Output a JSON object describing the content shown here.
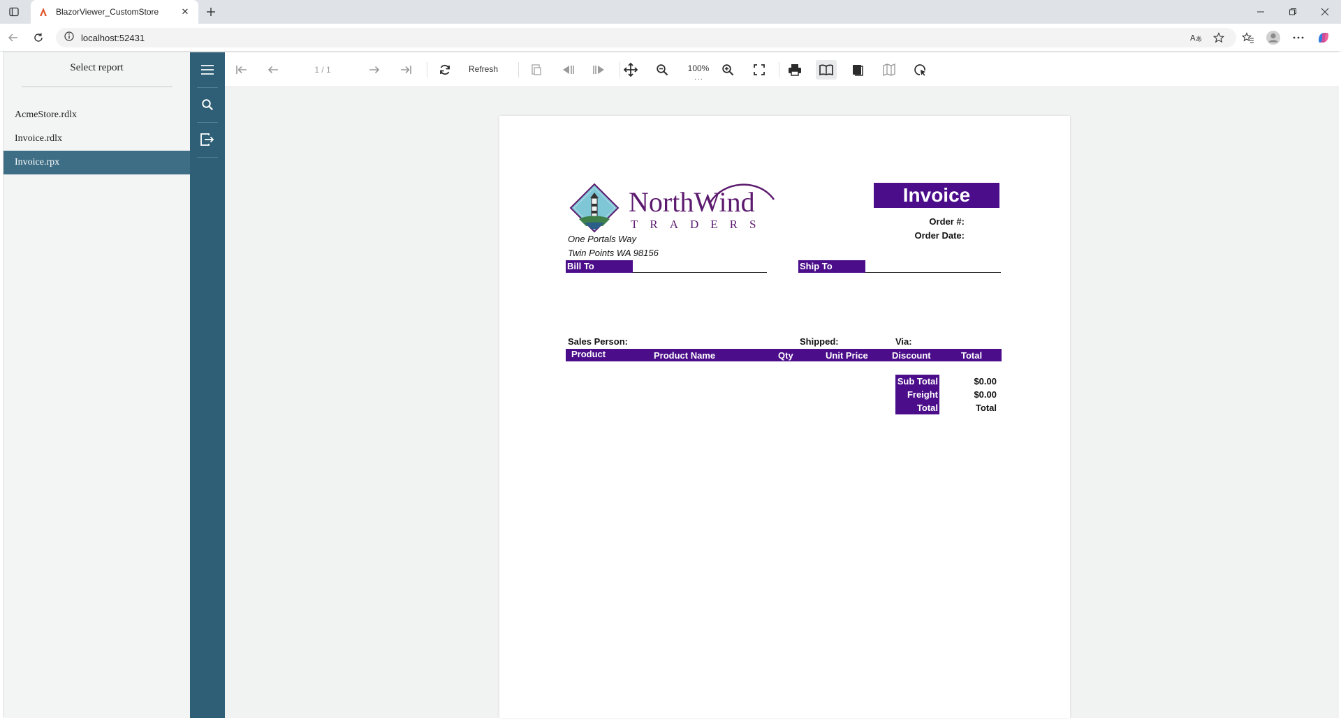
{
  "browser": {
    "tab_title": "BlazorViewer_CustomStore",
    "url": "localhost:52431",
    "icons": {
      "tab_actions": "tab-actions-icon",
      "favicon": "app-favicon-icon",
      "close": "close-icon",
      "new_tab": "plus-icon",
      "minimize": "minimize-icon",
      "restore": "restore-icon",
      "window_close": "close-icon",
      "back": "back-arrow-icon",
      "reload": "reload-icon",
      "info": "info-icon",
      "read_aloud": "read-aloud-icon",
      "favorite": "star-icon",
      "favorites": "favorites-icon",
      "profile": "profile-icon",
      "more": "more-icon",
      "copilot": "copilot-icon"
    }
  },
  "reports": {
    "title": "Select report",
    "items": [
      {
        "label": "AcmeStore.rdlx",
        "selected": false
      },
      {
        "label": "Invoice.rdlx",
        "selected": false
      },
      {
        "label": "Invoice.rpx",
        "selected": true
      }
    ],
    "selected_bg": "#3e6e85"
  },
  "sidebar": {
    "color": "#2e5f76",
    "icons": [
      "menu-icon",
      "search-icon",
      "export-icon"
    ]
  },
  "toolbar": {
    "page_value": "1 / 1",
    "refresh_label": "Refresh",
    "zoom_value": "100%",
    "icons": [
      "first-page-icon",
      "previous-page-icon",
      "next-page-icon",
      "last-page-icon",
      "refresh-icon",
      "parameters-icon",
      "history-back-icon",
      "history-forward-icon",
      "pan-icon",
      "zoom-out-icon",
      "zoom-in-icon",
      "fullscreen-icon",
      "print-icon",
      "single-page-icon",
      "continuous-icon",
      "galley-icon",
      "mouse-mode-icon"
    ]
  },
  "report": {
    "brand_line1": "NorthWind",
    "brand_line2": "TRADERS",
    "address_line1": "One Portals Way",
    "address_line2": "Twin Points WA  98156",
    "invoice_title": "Invoice",
    "order_no_label": "Order #:",
    "order_date_label": "Order Date:",
    "bill_to_label": "Bill To",
    "ship_to_label": "Ship To",
    "sales_person_label": "Sales Person:",
    "shipped_label": "Shipped:",
    "via_label": "Via:",
    "columns": [
      "Product",
      "Product Name",
      "Qty",
      "Unit Price",
      "Discount",
      "Total"
    ],
    "totals": [
      {
        "label": "Sub Total",
        "value": "$0.00"
      },
      {
        "label": "Freight",
        "value": "$0.00"
      },
      {
        "label": "Total",
        "value": "Total"
      }
    ],
    "accent_color": "#4b0d8a",
    "brand_color": "#5c1a6e"
  }
}
